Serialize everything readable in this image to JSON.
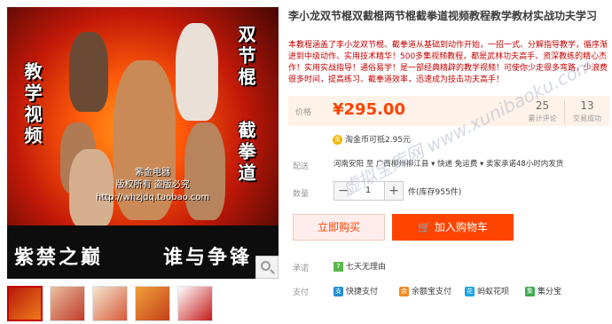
{
  "image": {
    "left_vertical": "教学视频",
    "right_vertical_1": "双节棍",
    "right_vertical_2": "截拳道",
    "watermark_lines": [
      "紫金电器",
      "版权所有  盗版必究",
      "http://whzjdq.taobao.com"
    ],
    "banner_left": "紫禁之巅",
    "banner_right": "谁与争锋",
    "zoom_icon": "magnifier-icon"
  },
  "thumbnails": [
    "thumb-1",
    "thumb-2",
    "thumb-3",
    "thumb-4",
    "thumb-5"
  ],
  "product": {
    "title": "李小龙双节棍双截棍两节棍截拳道视频教程教学教材实战功夫学习",
    "description": "本教程涵盖了李小龙双节棍、截拳道从基础到动作开始，一招一式、分解指导教学，循序渐进到中级动作、实用技术精华！500多集视频教程，都是武林功夫高手、资深教练的精心杰作！实用实战指导！通俗易学！是一部经典精辟的教学视频！可使你少走很多弯路，少浪费很多时间，提高练习、截拳道效率，迅速成为技击功夫高手！",
    "price_label": "价格",
    "price": "¥295.00",
    "reviews_count": "25",
    "reviews_label": "累计评论",
    "sold_count": "13",
    "sold_label": "交易成功",
    "coin_text": "淘金币可抵2.95元",
    "shipping_label": "配送",
    "shipping_text": "河南安阳 至  广西柳州柳江县 ▾    快递 免运费 ▾   卖家承诺48小时内发货",
    "quantity_label": "数量",
    "quantity_value": "1",
    "stock_text": "件(库存955件)",
    "buy_now": "立即购买",
    "add_cart": "加入购物车",
    "promise_label": "承诺",
    "promise_text": "七天无理由",
    "payment_label": "支付",
    "payments": [
      "快捷支付",
      "余额宝支付",
      "蚂蚁花呗",
      "集分宝"
    ]
  },
  "overlay_watermark": "虚拟宝库网 www.xunibaoku.com",
  "colors": {
    "accent": "#ff4400",
    "price": "#ff4400",
    "price_bg": "#fff2e8"
  }
}
